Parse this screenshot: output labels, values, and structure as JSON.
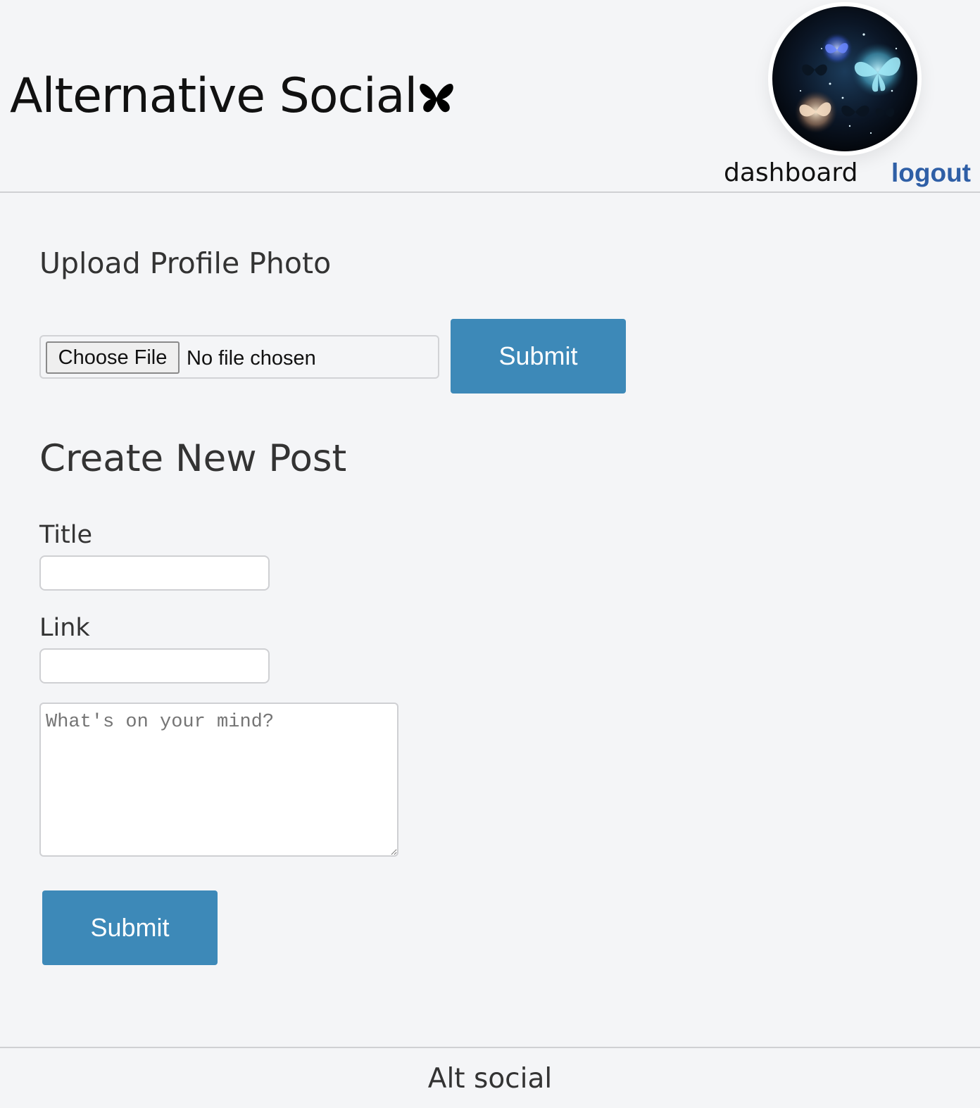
{
  "header": {
    "site_title": "Alternative Social",
    "title_icon": "butterfly-icon",
    "avatar_icon": "butterfly-avatar",
    "nav": {
      "dashboard_label": "dashboard",
      "logout_label": "logout"
    }
  },
  "upload_photo": {
    "heading": "Upload Profile Photo",
    "choose_file_label": "Choose File",
    "file_status": "No file chosen",
    "submit_label": "Submit"
  },
  "new_post": {
    "heading": "Create New Post",
    "title_label": "Title",
    "title_value": "",
    "link_label": "Link",
    "link_value": "",
    "body_placeholder": "What's on your mind?",
    "body_value": "",
    "submit_label": "Submit"
  },
  "footer": {
    "text": "Alt social"
  },
  "colors": {
    "background": "#f4f5f7",
    "accent_button": "#3d89b8",
    "logout_link": "#2f5fa6",
    "divider": "#cfd0d3"
  }
}
